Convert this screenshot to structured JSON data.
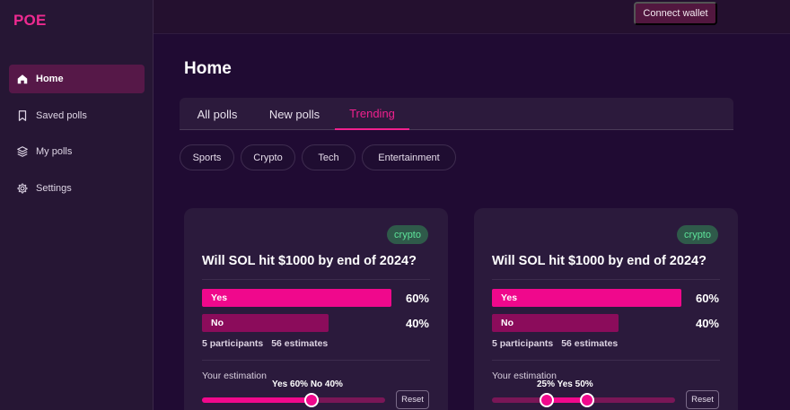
{
  "app": {
    "logo": "POE"
  },
  "sidebar": {
    "items": [
      {
        "label": "Home",
        "icon": "home-icon",
        "active": true
      },
      {
        "label": "Saved polls",
        "icon": "bookmark-icon",
        "active": false
      },
      {
        "label": "My polls",
        "icon": "layers-icon",
        "active": false
      },
      {
        "label": "Settings",
        "icon": "gear-icon",
        "active": false
      }
    ]
  },
  "topbar": {
    "connect_label": "Connect wallet"
  },
  "page": {
    "title": "Home"
  },
  "tabs": [
    {
      "label": "All polls",
      "active": false
    },
    {
      "label": "New polls",
      "active": false
    },
    {
      "label": "Trending",
      "active": true
    }
  ],
  "categories": [
    "Sports",
    "Crypto",
    "Tech",
    "Entertainment"
  ],
  "colors": {
    "accent": "#f0088c",
    "accent_dark": "#8b0c5b",
    "tag_bg": "#2f5a4a",
    "tag_text": "#5ee39a",
    "background": "#200b33",
    "sidebar_bg": "#261634"
  },
  "polls": [
    {
      "tag": "crypto",
      "question": "Will SOL hit $1000 by end of 2024?",
      "options": [
        {
          "label": "Yes",
          "percent_text": "60%",
          "share": 0.6
        },
        {
          "label": "No",
          "percent_text": "40%",
          "share": 0.4
        }
      ],
      "participants": "5 participants",
      "estimates": "56 estimates",
      "estimation_label": "Your estimation",
      "estimation_text": "Yes 60% No 40%",
      "slider_values": [
        60
      ],
      "reset_label": "Reset"
    },
    {
      "tag": "crypto",
      "question": "Will SOL hit $1000 by end of 2024?",
      "options": [
        {
          "label": "Yes",
          "percent_text": "60%",
          "share": 0.6
        },
        {
          "label": "No",
          "percent_text": "40%",
          "share": 0.4
        }
      ],
      "participants": "5 participants",
      "estimates": "56 estimates",
      "estimation_label": "Your estimation",
      "estimation_text": "25% Yes 50%",
      "slider_values": [
        30,
        52
      ],
      "reset_label": "Reset"
    }
  ]
}
